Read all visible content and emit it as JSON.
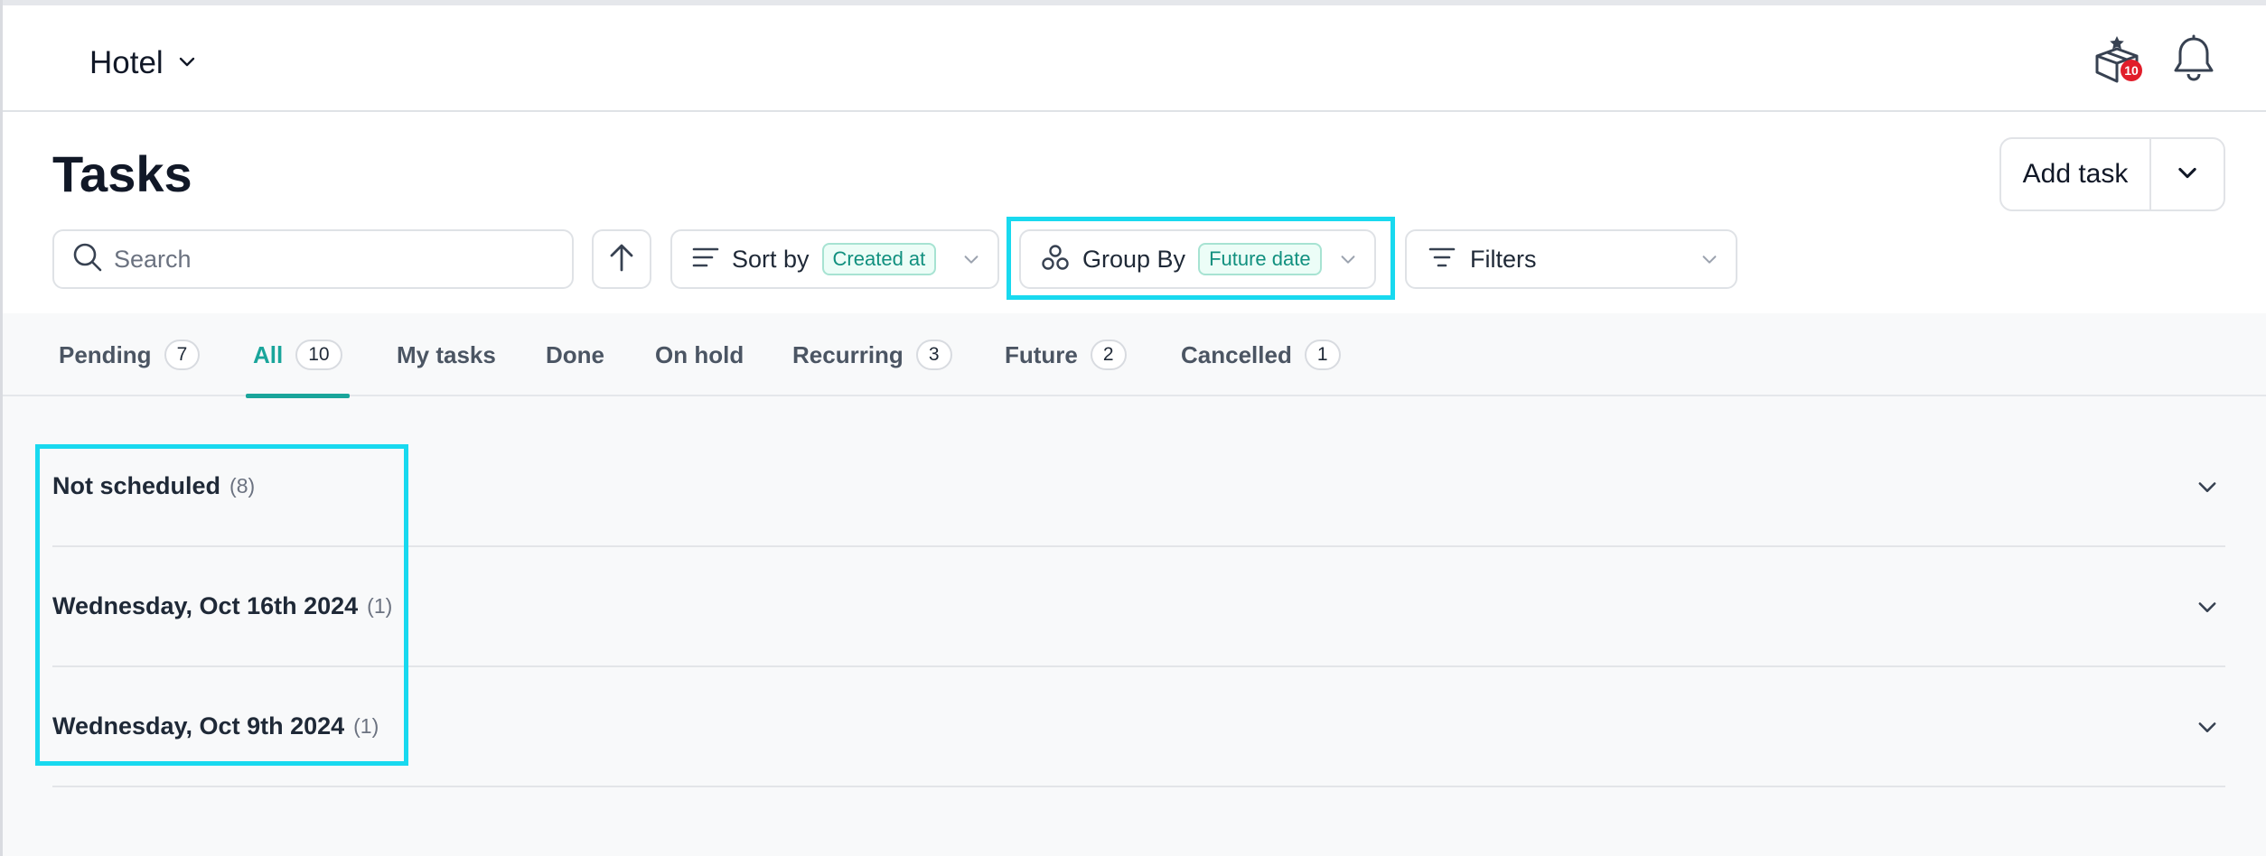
{
  "topbar": {
    "property_name": "Hotel",
    "gift_badge_count": "10"
  },
  "header": {
    "title": "Tasks",
    "add_task_label": "Add task"
  },
  "toolbar": {
    "search_placeholder": "Search",
    "sort_label": "Sort by",
    "sort_value": "Created at",
    "group_label": "Group By",
    "group_value": "Future date",
    "filters_label": "Filters"
  },
  "tabs": [
    {
      "label": "Pending",
      "count": "7"
    },
    {
      "label": "All",
      "count": "10"
    },
    {
      "label": "My tasks",
      "count": ""
    },
    {
      "label": "Done",
      "count": ""
    },
    {
      "label": "On hold",
      "count": ""
    },
    {
      "label": "Recurring",
      "count": "3"
    },
    {
      "label": "Future",
      "count": "2"
    },
    {
      "label": "Cancelled",
      "count": "1"
    }
  ],
  "active_tab": "All",
  "groups": [
    {
      "name": "Not scheduled",
      "count": "(8)"
    },
    {
      "name": "Wednesday, Oct 16th 2024",
      "count": "(1)"
    },
    {
      "name": "Wednesday, Oct 9th 2024",
      "count": "(1)"
    }
  ],
  "colors": {
    "accent": "#1aa59b",
    "highlight": "#18d9ef",
    "badge_red": "#e11d2a"
  }
}
